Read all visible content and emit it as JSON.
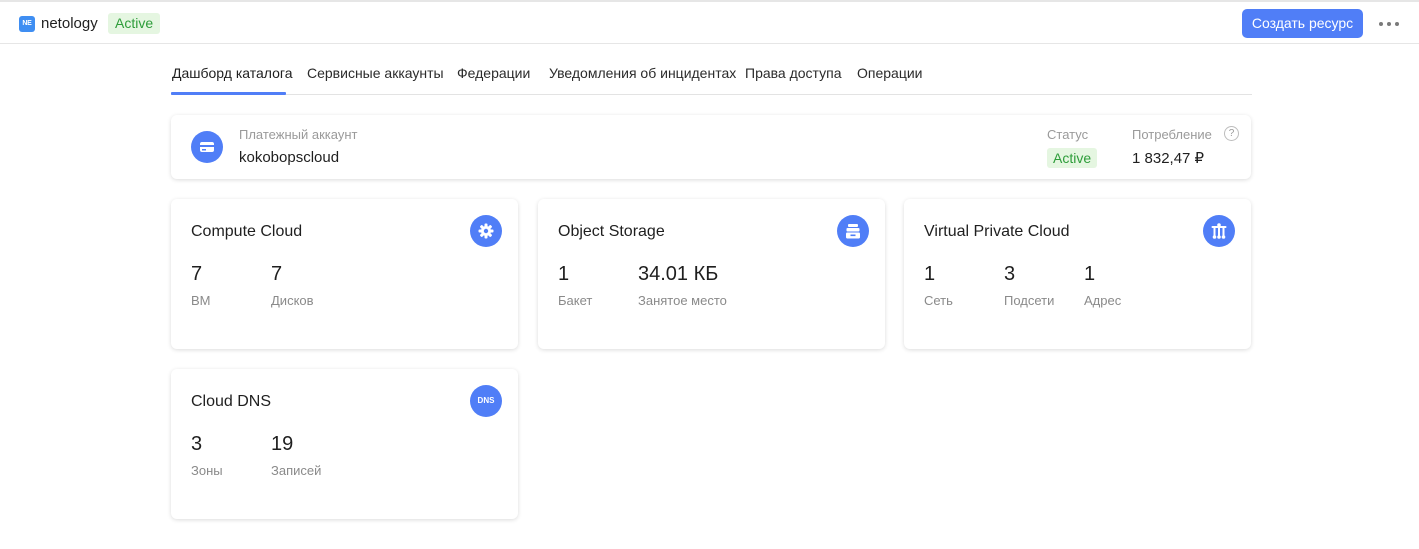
{
  "header": {
    "logo_text": "NE",
    "folder_name": "netology",
    "folder_status": "Active",
    "create_button_label": "Создать ресурс",
    "accent_color": "#507ef7"
  },
  "tabs": [
    {
      "label": "Дашборд каталога",
      "active": true
    },
    {
      "label": "Сервисные аккаунты",
      "active": false
    },
    {
      "label": "Федерации",
      "active": false
    },
    {
      "label": "Уведомления об инцидентах",
      "active": false
    },
    {
      "label": "Права доступа",
      "active": false
    },
    {
      "label": "Операции",
      "active": false
    }
  ],
  "billing": {
    "label": "Платежный аккаунт",
    "name": "kokobopscloud",
    "status_label": "Статус",
    "status_value": "Active",
    "consumption_label": "Потребление",
    "help_icon": "?",
    "consumption_value": "1 832,47 ₽"
  },
  "cards": [
    {
      "title": "Compute Cloud",
      "icon": "gear-icon",
      "metrics": [
        {
          "value": "7",
          "label": "ВМ"
        },
        {
          "value": "7",
          "label": "Дисков"
        }
      ]
    },
    {
      "title": "Object Storage",
      "icon": "storage-icon",
      "metrics": [
        {
          "value": "1",
          "label": "Бакет"
        },
        {
          "value": "34.01 КБ",
          "label": "Занятое место"
        }
      ]
    },
    {
      "title": "Virtual Private Cloud",
      "icon": "network-icon",
      "metrics": [
        {
          "value": "1",
          "label": "Сеть"
        },
        {
          "value": "3",
          "label": "Подсети"
        },
        {
          "value": "1",
          "label": "Адрес"
        }
      ]
    },
    {
      "title": "Cloud DNS",
      "icon": "dns-icon",
      "icon_text": "DNS",
      "metrics": [
        {
          "value": "3",
          "label": "Зоны"
        },
        {
          "value": "19",
          "label": "Записей"
        }
      ]
    }
  ]
}
